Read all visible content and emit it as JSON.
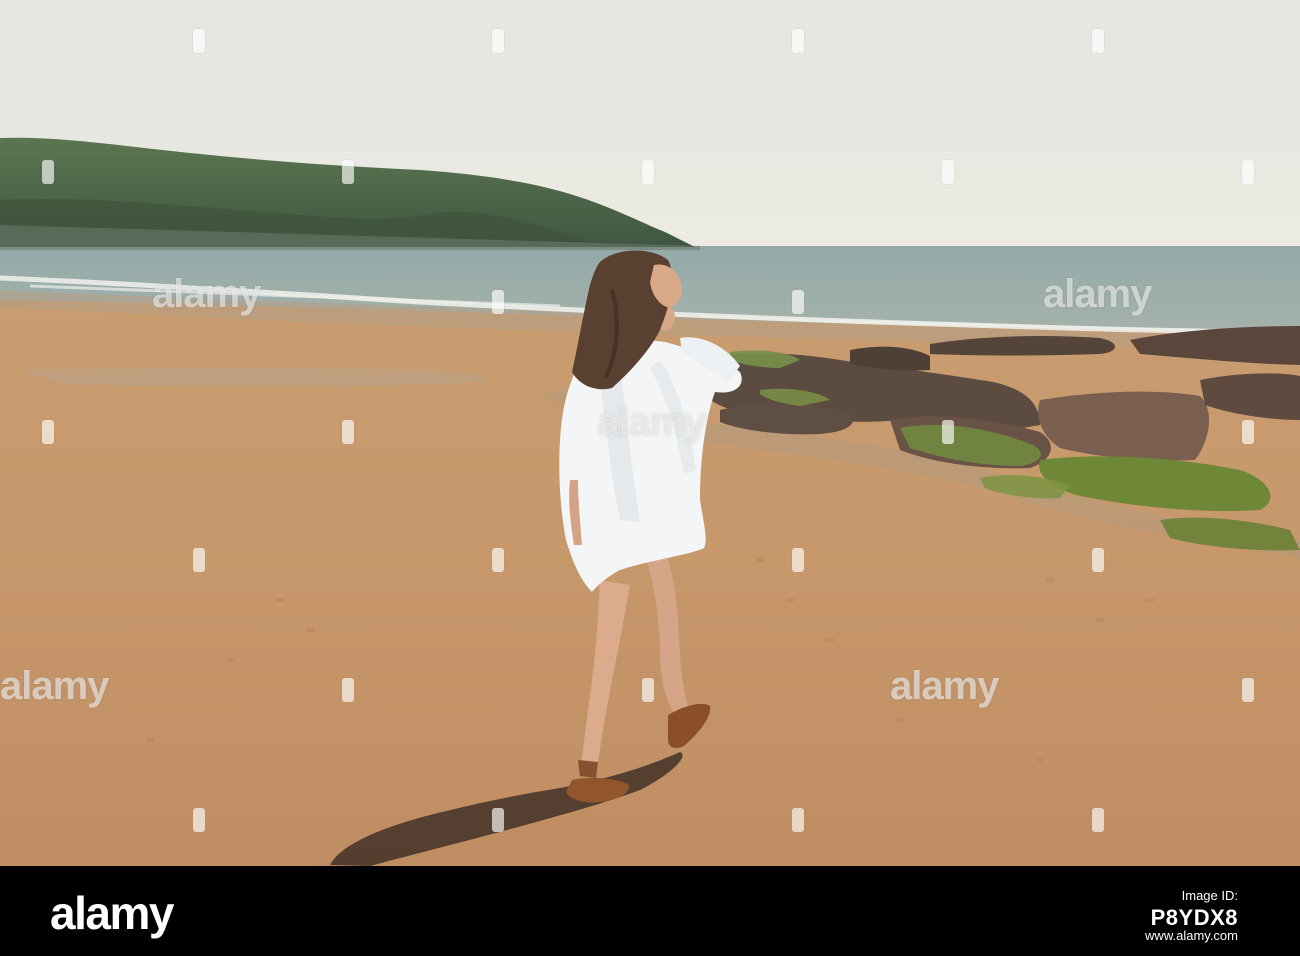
{
  "photo": {
    "subject": "woman-walking-on-beach",
    "colors": {
      "sky": "#e7e8e2",
      "sea": "#8fa7a6",
      "headland": "#4f6a49",
      "sand": "#c79a6c",
      "dress": "#f3f5f6",
      "rocks": "#5a4a40",
      "moss": "#6f8a3c",
      "hair": "#5a4030",
      "skin": "#d8a888"
    }
  },
  "watermark": {
    "word": "alamy"
  },
  "footer": {
    "logo": "alamy",
    "image_id_label": "Image ID:",
    "image_id": "P8YDX8",
    "site": "www.alamy.com"
  }
}
